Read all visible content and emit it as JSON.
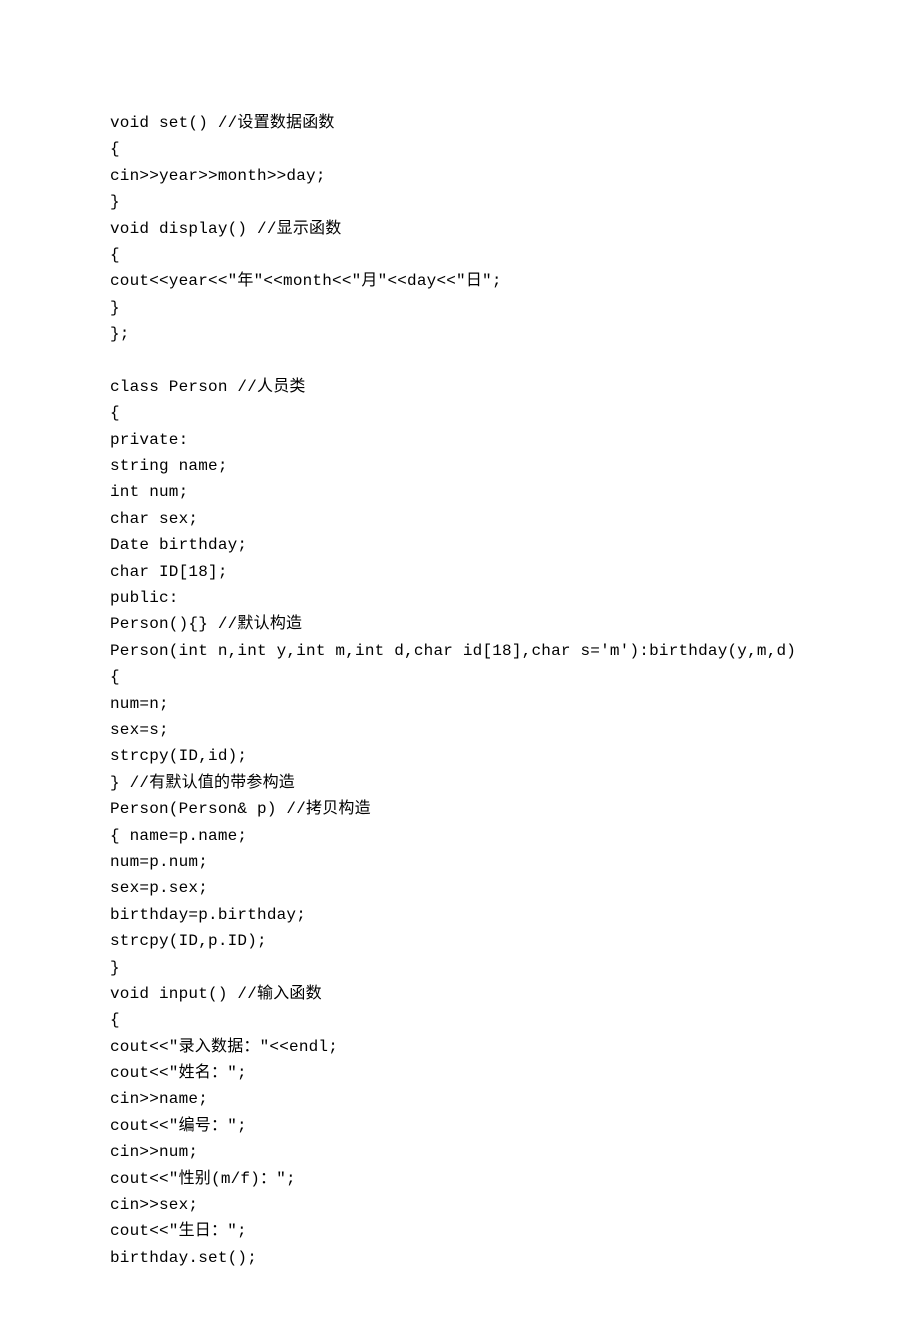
{
  "code": {
    "lines": [
      "void set() //设置数据函数",
      "{",
      "cin>>year>>month>>day;",
      "}",
      "void display() //显示函数",
      "{",
      "cout<<year<<\"年\"<<month<<\"月\"<<day<<\"日\";",
      "}",
      "};",
      "",
      "class Person //人员类",
      "{",
      "private:",
      "string name;",
      "int num;",
      "char sex;",
      "Date birthday;",
      "char ID[18];",
      "public:",
      "Person(){} //默认构造",
      "Person(int n,int y,int m,int d,char id[18],char s='m'):birthday(y,m,d)",
      "{",
      "num=n;",
      "sex=s;",
      "strcpy(ID,id);",
      "} //有默认值的带参构造",
      "Person(Person& p) //拷贝构造",
      "{ name=p.name;",
      "num=p.num;",
      "sex=p.sex;",
      "birthday=p.birthday;",
      "strcpy(ID,p.ID);",
      "}",
      "void input() //输入函数",
      "{",
      "cout<<\"录入数据：\"<<endl;",
      "cout<<\"姓名：\";",
      "cin>>name;",
      "cout<<\"编号：\";",
      "cin>>num;",
      "cout<<\"性别(m/f)：\";",
      "cin>>sex;",
      "cout<<\"生日：\";",
      "birthday.set();"
    ]
  }
}
